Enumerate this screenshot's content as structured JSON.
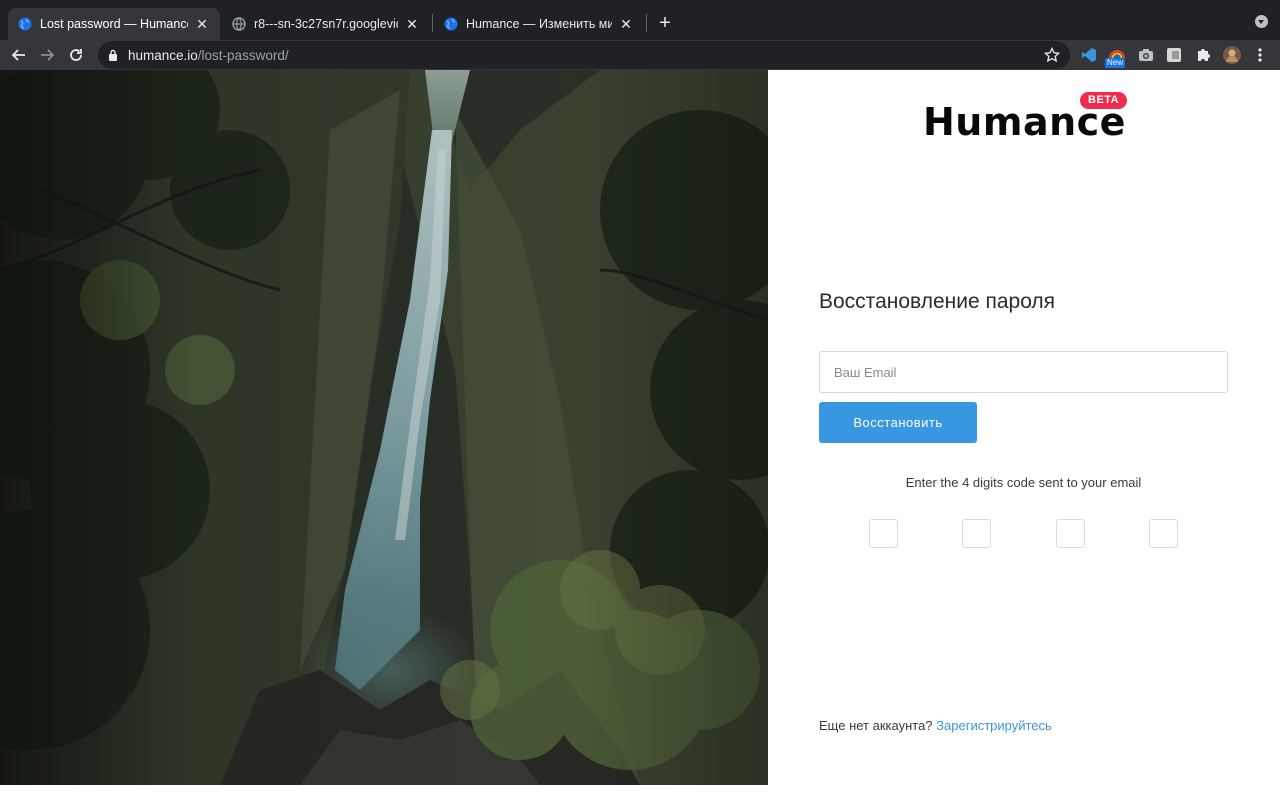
{
  "browser": {
    "tabs": [
      {
        "title": "Lost password — Humance",
        "active": true,
        "icon": "globe-icon"
      },
      {
        "title": "r8---sn-3c27sn7r.googlevideo",
        "active": false,
        "icon": "globe-icon"
      },
      {
        "title": "Humance — Изменить мир в лучшую сторону",
        "active": false,
        "icon": "globe-icon"
      }
    ],
    "url_domain": "humance.io",
    "url_path": "/lost-password/",
    "extensions": [
      "vscode-icon",
      "rainbow-new-icon",
      "camera-icon",
      "extension-tile-icon",
      "puzzle-icon",
      "avatar",
      "more-icon"
    ],
    "new_badge": "New"
  },
  "brand": {
    "logo": "Humance",
    "badge": "BETA",
    "badge_color": "#ef2b4e",
    "accent_color": "#3797e0"
  },
  "form": {
    "heading": "Восстановление пароля",
    "email_placeholder": "Ваш Email",
    "email_value": "",
    "submit_label": "Восстановить",
    "code_hint": "Enter the 4 digits code sent to your email",
    "code_digits": [
      "",
      "",
      "",
      ""
    ]
  },
  "footer": {
    "prompt": "Еще нет аккаунта?",
    "signup_link": "Зарегистрируйтесь"
  }
}
